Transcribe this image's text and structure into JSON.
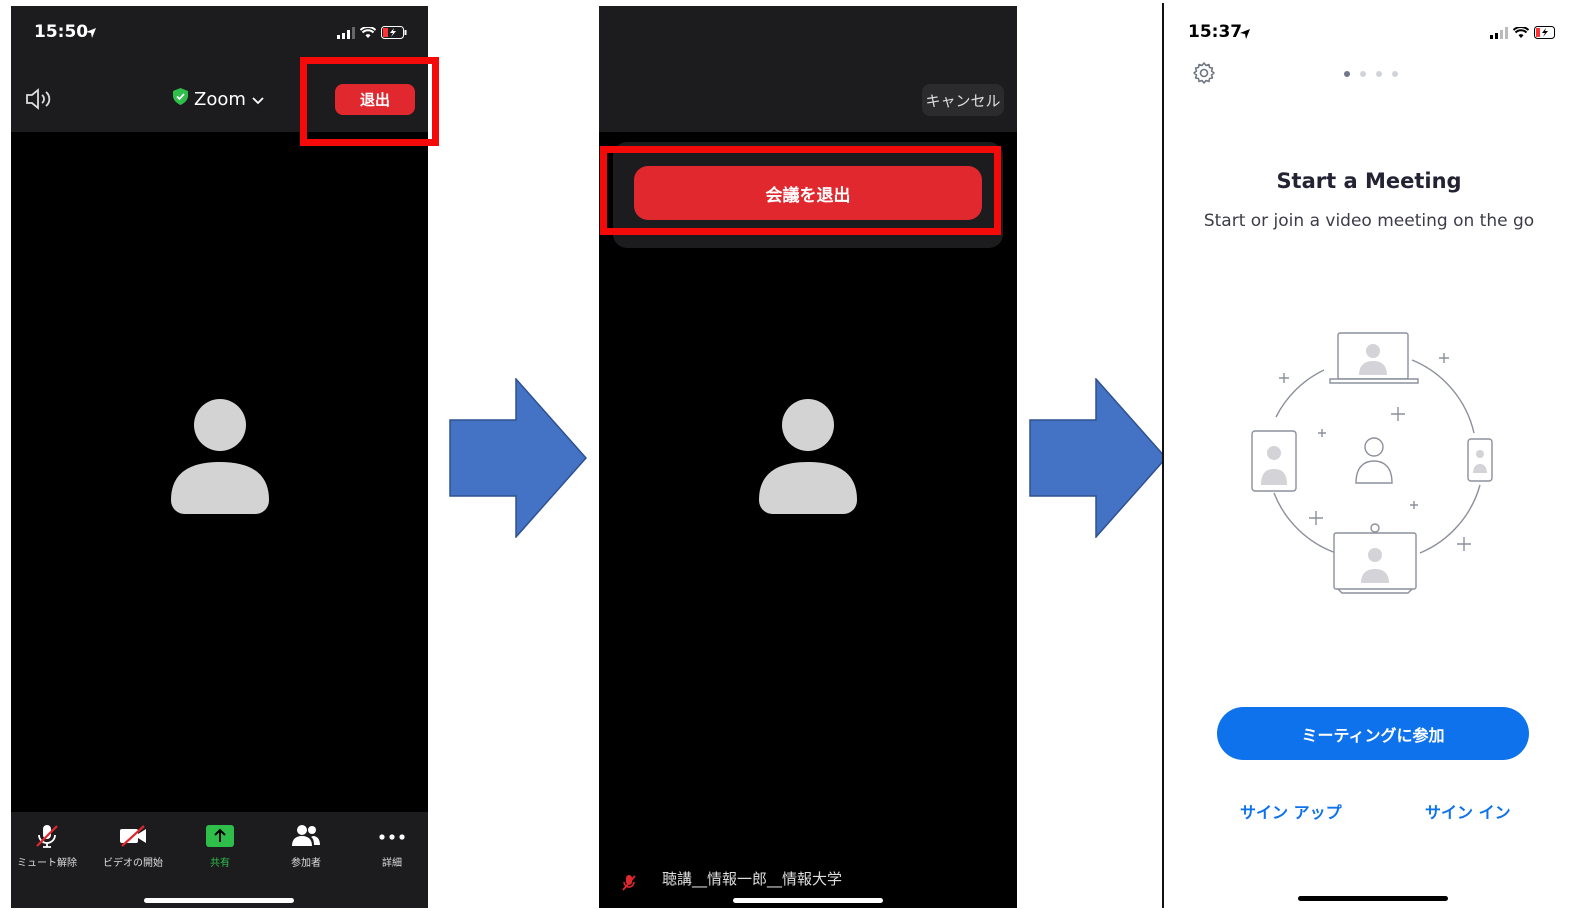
{
  "colors": {
    "zoom_red": "#e0282e",
    "highlight_red": "#f50a0a",
    "zoom_blue": "#0e72ed",
    "arrow_blue": "#4472c4",
    "share_green": "#2fbe4a"
  },
  "screen1": {
    "status_time": "15:50",
    "meeting_title": "Zoom",
    "leave_label": "退出",
    "toolbar": [
      {
        "icon": "muted-mic-icon",
        "label": "ミュート解除"
      },
      {
        "icon": "video-off-icon",
        "label": "ビデオの開始"
      },
      {
        "icon": "share-screen-icon",
        "label": "共有"
      },
      {
        "icon": "participants-icon",
        "label": "参加者"
      },
      {
        "icon": "more-icon",
        "label": "詳細"
      }
    ]
  },
  "screen2": {
    "cancel_label": "キャンセル",
    "leave_meeting_label": "会議を退出",
    "participant_name": "聴講__情報一郎__情報大学"
  },
  "screen3": {
    "status_time": "15:37",
    "title": "Start a Meeting",
    "subtitle": "Start or join a video meeting on the go",
    "join_label": "ミーティングに参加",
    "signup_label": "サイン アップ",
    "signin_label": "サイン イン"
  }
}
